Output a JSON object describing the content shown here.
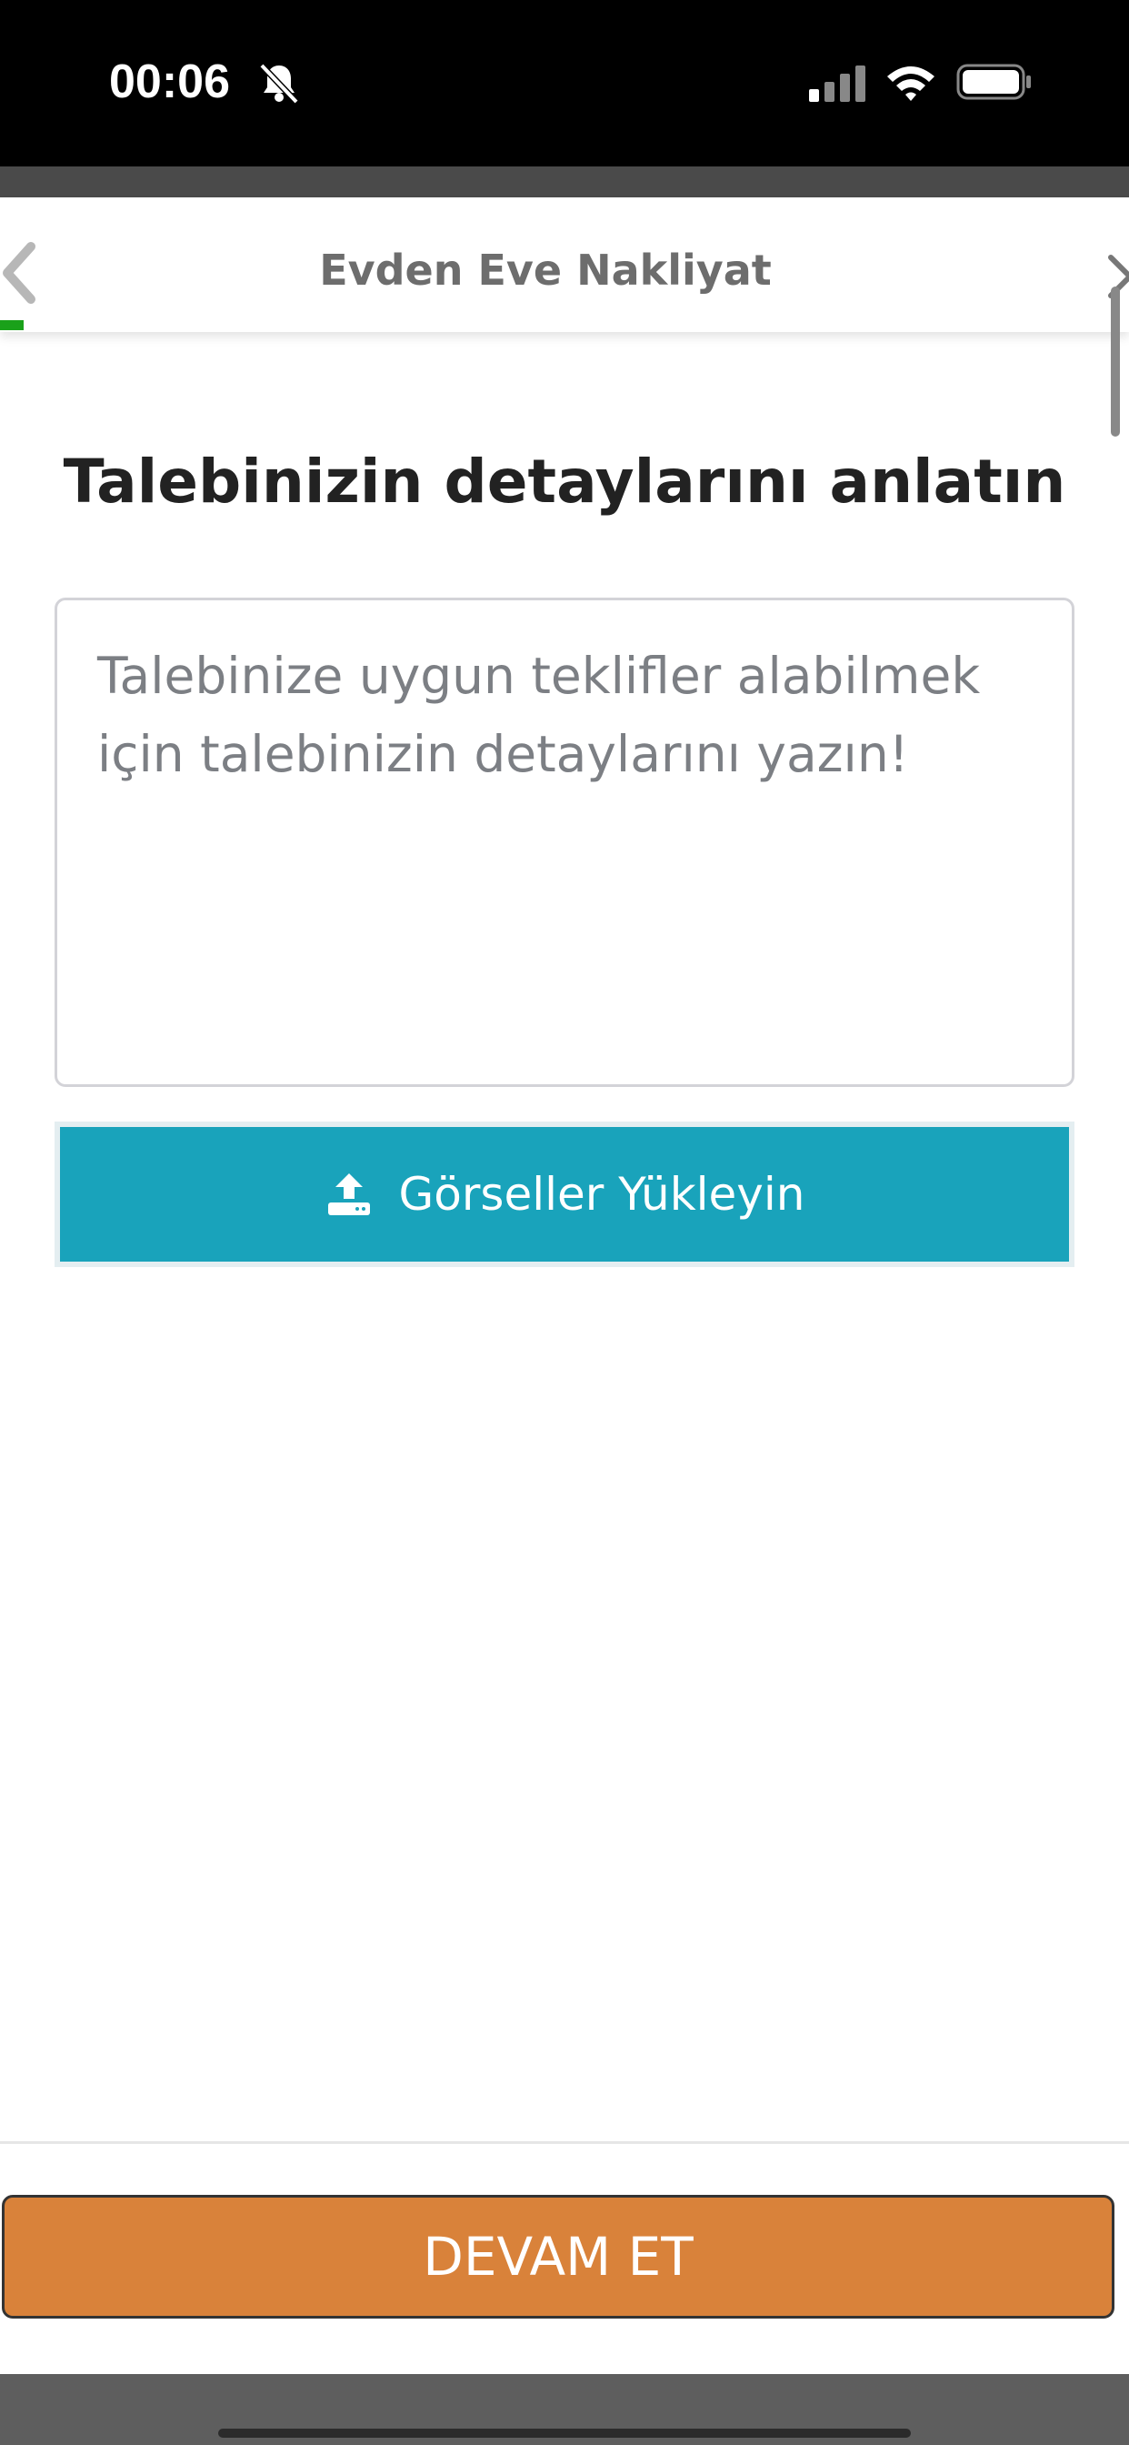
{
  "status_bar": {
    "time": "00:06",
    "icons": [
      "bell-slash-icon",
      "cellular-signal-icon",
      "wifi-icon",
      "battery-icon"
    ]
  },
  "header": {
    "title": "Evden Eve Nakliyat",
    "back_icon": "chevron-left-icon",
    "close_icon": "close-icon",
    "progress_fraction": 0.02
  },
  "main": {
    "heading": "Talebinizin detaylarını anlatın",
    "details_field": {
      "value": "",
      "placeholder": "Talebinize uygun teklifler alabilmek için talebinizin detaylarını yazın!"
    },
    "upload_button": {
      "label": "Görseller Yükleyin",
      "icon": "upload-icon"
    }
  },
  "footer": {
    "continue_label": "DEVAM ET"
  },
  "colors": {
    "upload_button": "#19a3bb",
    "continue_button": "#d9823a",
    "progress": "#1aa11a"
  }
}
